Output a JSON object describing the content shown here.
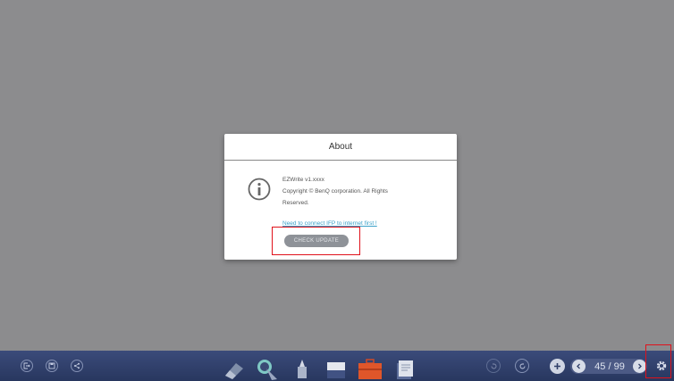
{
  "dialog": {
    "title": "About",
    "version": "EZWrite v1.xxxx",
    "copyright_line1": "Copyright © BenQ corporation. All Rights",
    "copyright_line2": "Reserved.",
    "connect_notice": "Need to connect IFP to internet first !",
    "check_update_label": "CHECK UPDATE"
  },
  "toolbar": {
    "left_icons": [
      "exit-icon",
      "save-icon",
      "share-icon"
    ],
    "center_tools": [
      "eraser-icon",
      "pen-icon",
      "highlighter-icon",
      "marker-icon",
      "toolbox-icon",
      "notes-icon"
    ],
    "right_icons": [
      "undo-icon",
      "redo-icon",
      "add-page-icon",
      "prev-page-icon",
      "next-page-icon",
      "settings-icon"
    ],
    "page_counter": "45 / 99"
  },
  "colors": {
    "canvas": "#8c8c8e",
    "toolbar": "#2f3e68",
    "highlight": "#e0121b",
    "link": "#3aa0c8"
  }
}
